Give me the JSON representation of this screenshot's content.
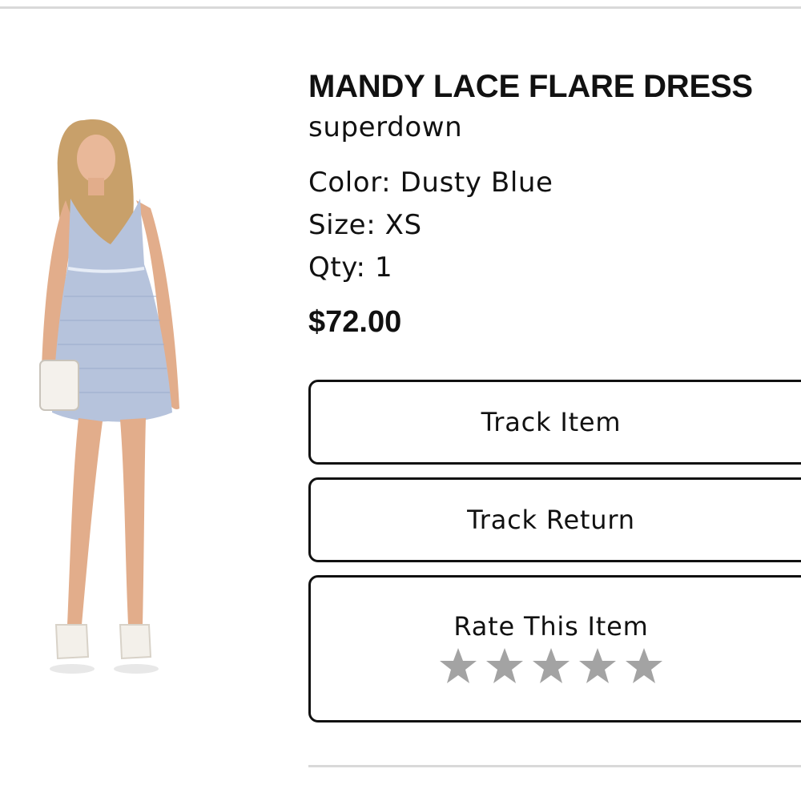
{
  "product": {
    "title": "MANDY LACE FLARE DRESS",
    "brand": "superdown",
    "color": "Color: Dusty Blue",
    "size": "Size: XS",
    "qty": "Qty: 1",
    "price": "$72.00",
    "image_icon": "dress-photo"
  },
  "actions": {
    "track_item": "Track Item",
    "track_return": "Track Return",
    "rate_title": "Rate This Item",
    "rating": {
      "value": 0,
      "max": 5,
      "star_color": "#a3a3a3"
    }
  },
  "colors": {
    "dress": "#b6c3dc",
    "text": "#111111",
    "divider": "#d9d9d9"
  }
}
